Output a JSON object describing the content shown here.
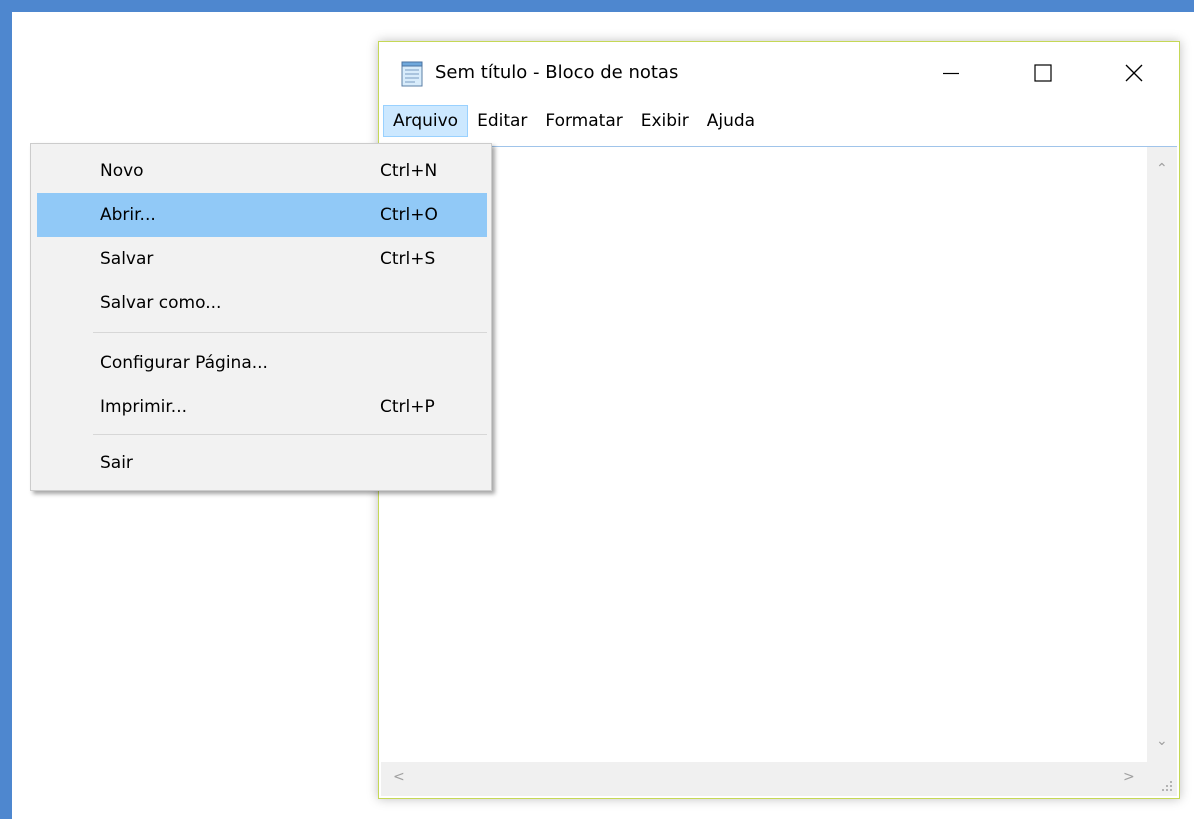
{
  "window": {
    "title": "Sem título - Bloco de notas",
    "controls": {
      "minimize_icon": "minimize-icon",
      "maximize_icon": "maximize-icon",
      "close_icon": "close-icon"
    }
  },
  "menubar": {
    "items": [
      {
        "label": "Arquivo",
        "active": true
      },
      {
        "label": "Editar",
        "active": false
      },
      {
        "label": "Formatar",
        "active": false
      },
      {
        "label": "Exibir",
        "active": false
      },
      {
        "label": "Ajuda",
        "active": false
      }
    ]
  },
  "file_menu": {
    "items": [
      {
        "label": "Novo",
        "shortcut": "Ctrl+N",
        "highlighted": false
      },
      {
        "label": "Abrir...",
        "shortcut": "Ctrl+O",
        "highlighted": true
      },
      {
        "label": "Salvar",
        "shortcut": "Ctrl+S",
        "highlighted": false
      },
      {
        "label": "Salvar como...",
        "shortcut": "",
        "highlighted": false
      },
      {
        "label": "Configurar Página...",
        "shortcut": "",
        "highlighted": false
      },
      {
        "label": "Imprimir...",
        "shortcut": "Ctrl+P",
        "highlighted": false
      },
      {
        "label": "Sair",
        "shortcut": "",
        "highlighted": false
      }
    ]
  },
  "editor": {
    "text": ""
  },
  "colors": {
    "desktop_frame": "#4e87cf",
    "menu_active_bg": "#cce8ff",
    "menu_highlight_bg": "#91c9f7",
    "window_border": "#c5d856"
  }
}
